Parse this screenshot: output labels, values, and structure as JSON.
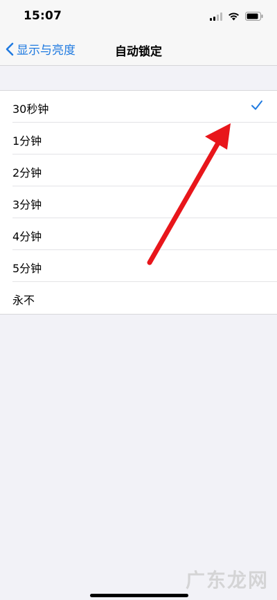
{
  "status_bar": {
    "time": "15:07",
    "icons": [
      "signal-icon",
      "wifi-icon",
      "battery-icon"
    ]
  },
  "nav": {
    "back_label": "显示与亮度",
    "title": "自动锁定"
  },
  "options": [
    {
      "label": "30秒钟",
      "selected": true
    },
    {
      "label": "1分钟",
      "selected": false
    },
    {
      "label": "2分钟",
      "selected": false
    },
    {
      "label": "3分钟",
      "selected": false
    },
    {
      "label": "4分钟",
      "selected": false
    },
    {
      "label": "5分钟",
      "selected": false
    },
    {
      "label": "永不",
      "selected": false
    }
  ],
  "colors": {
    "accent": "#1f7ae0",
    "background": "#f2f2f7",
    "annotation_arrow": "#e8161b"
  },
  "watermark": "广东龙网"
}
